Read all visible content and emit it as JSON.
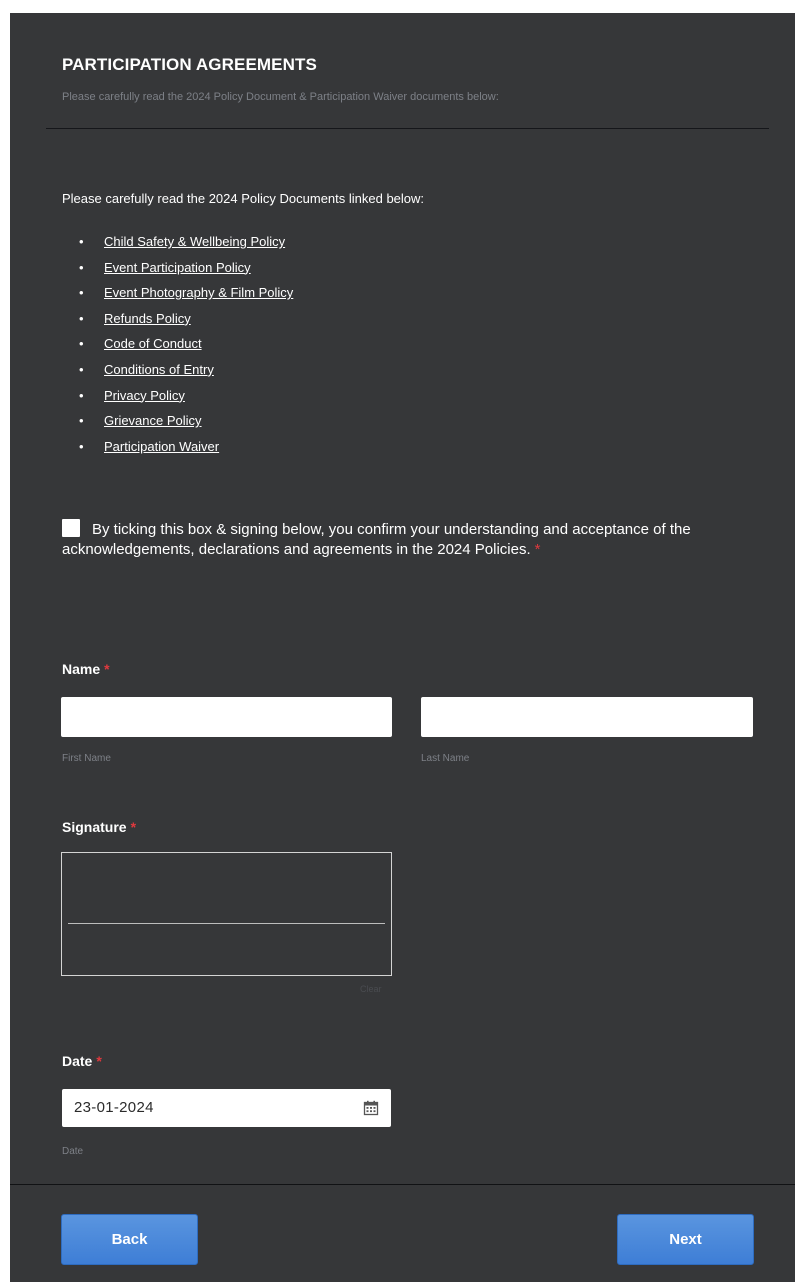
{
  "section": {
    "title": "PARTICIPATION AGREEMENTS",
    "subtitle": "Please carefully read the 2024 Policy Document & Participation Waiver documents below:"
  },
  "policies": {
    "intro": "Please carefully read the 2024 Policy Documents linked below:",
    "items": [
      {
        "label": "Child Safety & Wellbeing Policy"
      },
      {
        "label": "Event Participation Policy"
      },
      {
        "label": "Event Photography & Film Policy"
      },
      {
        "label": "Refunds Policy"
      },
      {
        "label": "Code of Conduct"
      },
      {
        "label": "Conditions of Entry"
      },
      {
        "label": "Privacy Policy"
      },
      {
        "label": "Grievance Policy"
      },
      {
        "label": "Participation Waiver"
      }
    ]
  },
  "consent": {
    "text": "By ticking this box & signing below, you confirm your understanding and acceptance of the acknowledgements, declarations and agreements in the 2024 Policies.",
    "checked": false,
    "required_mark": "*"
  },
  "name_field": {
    "label": "Name",
    "required_mark": "*",
    "first_value": "",
    "last_value": "",
    "first_sublabel": "First Name",
    "last_sublabel": "Last Name"
  },
  "signature_field": {
    "label": "Signature",
    "required_mark": "*",
    "clear_label": "Clear"
  },
  "date_field": {
    "label": "Date",
    "required_mark": "*",
    "value": "23-01-2024",
    "sublabel": "Date",
    "icon": "calendar-icon"
  },
  "buttons": {
    "back": "Back",
    "next": "Next"
  },
  "colors": {
    "background": "#363739",
    "accent": "#4a89dc",
    "required": "#e0393e",
    "muted_text": "#7d8087"
  }
}
